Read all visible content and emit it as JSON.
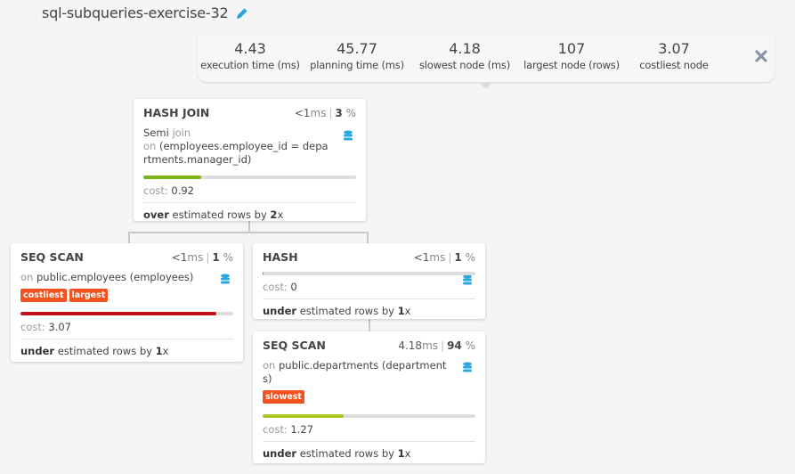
{
  "title": "sql-subqueries-exercise-32",
  "stats": [
    {
      "value": "4.43",
      "label": "execution time (ms)"
    },
    {
      "value": "45.77",
      "label": "planning time (ms)"
    },
    {
      "value": "4.18",
      "label": "slowest node (ms)"
    },
    {
      "value": "107",
      "label": "largest node (rows)"
    },
    {
      "value": "3.07",
      "label": "costliest node"
    }
  ],
  "nodes": {
    "hash_join": {
      "name": "HASH JOIN",
      "time": "<1",
      "time_unit": "ms",
      "percent": "3",
      "percent_sign": "%",
      "join_type": "Semi",
      "join_word": "join",
      "on_word": "on",
      "condition": "(employees.employee_id = departments.manager_id)",
      "cost_label": "cost:",
      "cost": "0.92",
      "cost_fraction": 0.27,
      "bar_color": "#7cb518",
      "estimate_dir": "over",
      "estimate_text": "estimated rows by",
      "estimate_factor": "2",
      "estimate_x": "x"
    },
    "seq_scan_employees": {
      "name": "SEQ SCAN",
      "time": "<1",
      "time_unit": "ms",
      "percent": "1",
      "percent_sign": "%",
      "on_word": "on",
      "relation": "public.employees (employees)",
      "badges": [
        "costliest",
        "largest"
      ],
      "cost_label": "cost:",
      "cost": "3.07",
      "cost_fraction": 0.92,
      "bar_color": "#c0101a",
      "estimate_dir": "under",
      "estimate_text": "estimated rows by",
      "estimate_factor": "1",
      "estimate_x": "x"
    },
    "hash": {
      "name": "HASH",
      "time": "<1",
      "time_unit": "ms",
      "percent": "1",
      "percent_sign": "%",
      "cost_label": "cost:",
      "cost": "0",
      "cost_fraction": 0.005,
      "bar_color": "#3bb54a",
      "estimate_dir": "under",
      "estimate_text": "estimated rows by",
      "estimate_factor": "1",
      "estimate_x": "x"
    },
    "seq_scan_departments": {
      "name": "SEQ SCAN",
      "time": "4.18",
      "time_unit": "ms",
      "percent": "94",
      "percent_sign": "%",
      "on_word": "on",
      "relation": "public.departments (departments)",
      "badges": [
        "slowest"
      ],
      "cost_label": "cost:",
      "cost": "1.27",
      "cost_fraction": 0.38,
      "bar_color": "#a8c520",
      "estimate_dir": "under",
      "estimate_text": "estimated rows by",
      "estimate_factor": "1",
      "estimate_x": "x"
    }
  },
  "icons": {
    "edit": "pencil-icon",
    "close": "close-icon",
    "database": "database-icon"
  }
}
